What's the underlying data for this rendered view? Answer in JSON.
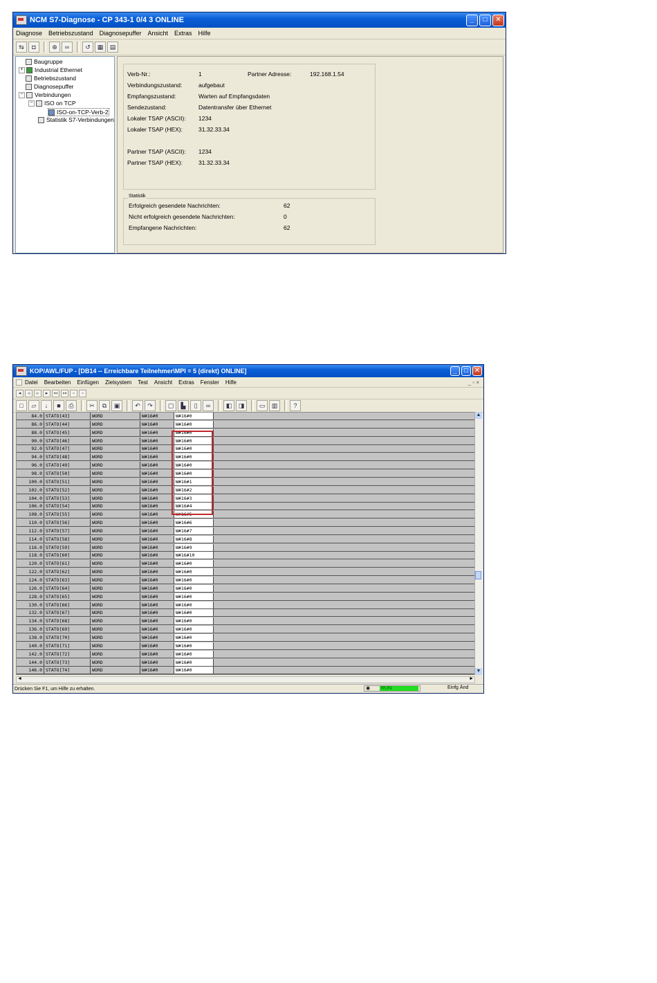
{
  "window1": {
    "title": "NCM S7-Diagnose - CP 343-1 0/4 3 ONLINE",
    "menu": [
      "Diagnose",
      "Betriebszustand",
      "Diagnosepuffer",
      "Ansicht",
      "Extras",
      "Hilfe"
    ],
    "tree": [
      {
        "label": "Baugruppe",
        "icon": "module-icon",
        "level": 1
      },
      {
        "label": "Industrial Ethernet",
        "icon": "network-icon",
        "level": 1
      },
      {
        "label": "Betriebszustand",
        "icon": "status-icon",
        "level": 1
      },
      {
        "label": "Diagnosepuffer",
        "icon": "buffer-icon",
        "level": 1
      },
      {
        "label": "Verbindungen",
        "icon": "connections-icon",
        "level": 1
      },
      {
        "label": "ISO on TCP",
        "icon": "connections-icon",
        "level": 2
      },
      {
        "label": "ISO-on-TCP-Verb-2",
        "icon": "connection-icon",
        "level": 3
      },
      {
        "label": "Statistik S7-Verbindungen",
        "icon": "statistics-icon",
        "level": 2
      }
    ],
    "detail": {
      "verb_nr_label": "Verb-Nr.:",
      "verb_nr": "1",
      "partner_adresse_label": "Partner Adresse:",
      "partner_adresse": "192.168.1.54",
      "verbindungszustand_label": "Verbindungszustand:",
      "verbindungszustand": "aufgebaut",
      "empfangszustand_label": "Empfangszustand:",
      "empfangszustand": "Warten auf Empfangsdaten",
      "sendezustand_label": "Sendezustand:",
      "sendezustand": "Datentransfer über Ethernet",
      "lokal_ascii_label": "Lokaler TSAP (ASCII):",
      "lokal_ascii": "1234",
      "lokal_hex_label": "Lokaler TSAP (HEX):",
      "lokal_hex": "31.32.33.34",
      "partner_ascii_label": "Partner TSAP (ASCII):",
      "partner_ascii": "1234",
      "partner_hex_label": "Partner TSAP (HEX):",
      "partner_hex": "31.32.33.34"
    },
    "statistik": {
      "title": "Statistik",
      "gesendet_label": "Erfolgreich gesendete Nachrichten:",
      "gesendet": "62",
      "nicht_gesendet_label": "Nicht erfolgreich gesendete Nachrichten:",
      "nicht_gesendet": "0",
      "empfangen_label": "Empfangene Nachrichten:",
      "empfangen": "62"
    }
  },
  "window2": {
    "title": "KOP/AWL/FUP - [DB14 -- Erreichbare Teilnehmer\\MPI = 5 (direkt) ONLINE]",
    "menu": [
      "Datei",
      "Bearbeiten",
      "Einfügen",
      "Zielsystem",
      "Test",
      "Ansicht",
      "Extras",
      "Fenster",
      "Hilfe"
    ],
    "mdi_controls": "_ ▫ ×",
    "rows": [
      [
        "84.0",
        "STATO[43]",
        "WORD",
        "W#16#0",
        "W#16#0"
      ],
      [
        "86.0",
        "STATO[44]",
        "WORD",
        "W#16#0",
        "W#16#0"
      ],
      [
        "88.0",
        "STATO[45]",
        "WORD",
        "W#16#0",
        "W#16#0"
      ],
      [
        "90.0",
        "STATO[46]",
        "WORD",
        "W#16#0",
        "W#16#0"
      ],
      [
        "92.0",
        "STATO[47]",
        "WORD",
        "W#16#0",
        "W#16#0"
      ],
      [
        "94.0",
        "STATO[48]",
        "WORD",
        "W#16#0",
        "W#16#0"
      ],
      [
        "96.0",
        "STATO[49]",
        "WORD",
        "W#16#0",
        "W#16#0"
      ],
      [
        "98.0",
        "STATO[50]",
        "WORD",
        "W#16#0",
        "W#16#0"
      ],
      [
        "100.0",
        "STATO[51]",
        "WORD",
        "W#16#0",
        "W#16#1"
      ],
      [
        "102.0",
        "STATO[52]",
        "WORD",
        "W#16#0",
        "W#16#2"
      ],
      [
        "104.0",
        "STATO[53]",
        "WORD",
        "W#16#0",
        "W#16#3"
      ],
      [
        "106.0",
        "STATO[54]",
        "WORD",
        "W#16#0",
        "W#16#4"
      ],
      [
        "108.0",
        "STATO[55]",
        "WORD",
        "W#16#0",
        "W#16#5"
      ],
      [
        "110.0",
        "STATO[56]",
        "WORD",
        "W#16#0",
        "W#16#6"
      ],
      [
        "112.0",
        "STATO[57]",
        "WORD",
        "W#16#0",
        "W#16#7"
      ],
      [
        "114.0",
        "STATO[58]",
        "WORD",
        "W#16#0",
        "W#16#8"
      ],
      [
        "116.0",
        "STATO[59]",
        "WORD",
        "W#16#0",
        "W#16#9"
      ],
      [
        "118.0",
        "STATO[60]",
        "WORD",
        "W#16#0",
        "W#16#10"
      ],
      [
        "120.0",
        "STATO[61]",
        "WORD",
        "W#16#0",
        "W#16#0"
      ],
      [
        "122.0",
        "STATO[62]",
        "WORD",
        "W#16#0",
        "W#16#0"
      ],
      [
        "124.0",
        "STATO[63]",
        "WORD",
        "W#16#0",
        "W#16#0"
      ],
      [
        "126.0",
        "STATO[64]",
        "WORD",
        "W#16#0",
        "W#16#0"
      ],
      [
        "128.0",
        "STATO[65]",
        "WORD",
        "W#16#0",
        "W#16#0"
      ],
      [
        "130.0",
        "STATO[66]",
        "WORD",
        "W#16#0",
        "W#16#0"
      ],
      [
        "132.0",
        "STATO[67]",
        "WORD",
        "W#16#0",
        "W#16#0"
      ],
      [
        "134.0",
        "STATO[68]",
        "WORD",
        "W#16#0",
        "W#16#0"
      ],
      [
        "136.0",
        "STATO[69]",
        "WORD",
        "W#16#0",
        "W#16#0"
      ],
      [
        "138.0",
        "STATO[70]",
        "WORD",
        "W#16#0",
        "W#16#0"
      ],
      [
        "140.0",
        "STATO[71]",
        "WORD",
        "W#16#0",
        "W#16#0"
      ],
      [
        "142.0",
        "STATO[72]",
        "WORD",
        "W#16#0",
        "W#16#0"
      ],
      [
        "144.0",
        "STATO[73]",
        "WORD",
        "W#16#0",
        "W#16#0"
      ],
      [
        "146.0",
        "STATO[74]",
        "WORD",
        "W#16#0",
        "W#16#0"
      ]
    ],
    "status_text": "Drücken Sie F1, um Hilfe zu erhalten.",
    "run_label": "RUN",
    "mode_text": "Einfg  Änd",
    "highlight_color": "#c0282d",
    "run_color": "#22dd22"
  }
}
